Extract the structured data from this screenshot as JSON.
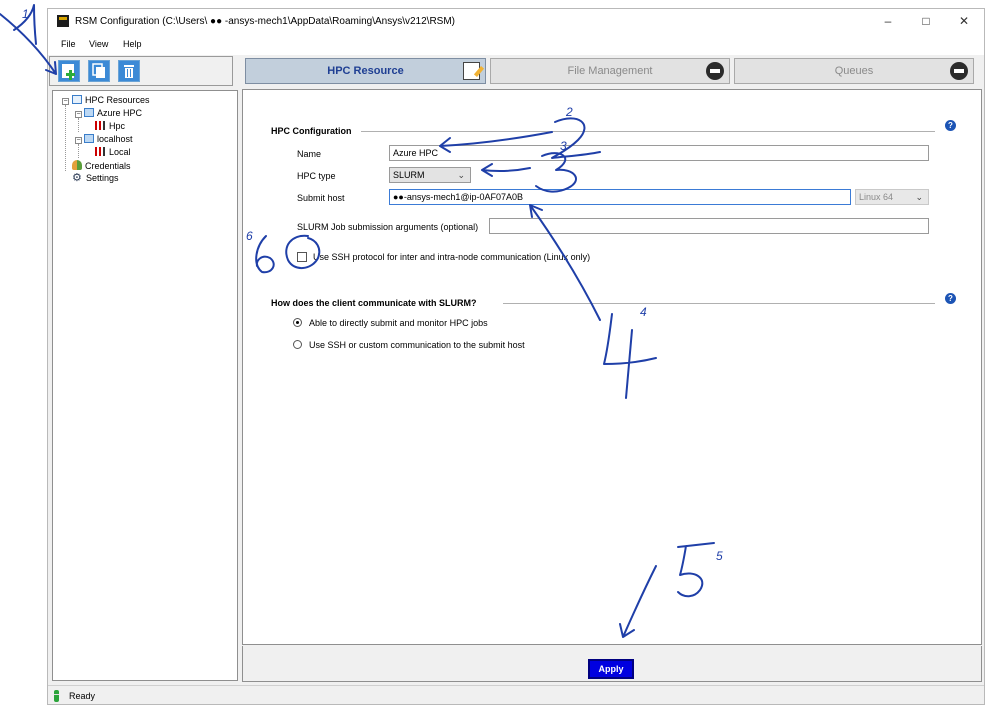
{
  "window": {
    "title": "RSM Configuration (C:\\Users\\ ●● -ansys-mech1\\AppData\\Roaming\\Ansys\\v212\\RSM)",
    "minimize": "–",
    "maximize": "□",
    "close": "✕"
  },
  "menu": [
    "File",
    "View",
    "Help"
  ],
  "tree": {
    "root": "HPC Resources",
    "azure": "Azure HPC",
    "azure_child": "Hpc",
    "localhost": "localhost",
    "localhost_child": "Local",
    "credentials": "Credentials",
    "settings": "Settings"
  },
  "tabs": [
    "HPC Resource",
    "File Management",
    "Queues"
  ],
  "hpc_config": {
    "title": "HPC Configuration",
    "name_label": "Name",
    "name_value": "Azure HPC",
    "type_label": "HPC type",
    "type_value": "SLURM",
    "host_label": "Submit host",
    "host_value": "●●-ansys-mech1@ip-0AF07A0B",
    "platform_value": "Linux 64",
    "args_label": "SLURM Job submission arguments (optional)",
    "args_value": "",
    "ssh_label": "Use SSH protocol for inter and intra-node communication (Linux only)"
  },
  "communicate": {
    "title": "How does the client communicate with SLURM?",
    "option1": "Able to directly submit and monitor HPC jobs",
    "option2": "Use SSH or custom communication to the submit host"
  },
  "help_glyph": "?",
  "apply_label": "Apply",
  "status": "Ready",
  "annotations": [
    "1",
    "2",
    "3",
    "4",
    "5",
    "6"
  ],
  "colors": {
    "annotation_ink": "#1f3fa8",
    "tab_active_text": "#1f3f93",
    "apply_bg": "#0000e0",
    "help_icon": "#1c54b5"
  }
}
